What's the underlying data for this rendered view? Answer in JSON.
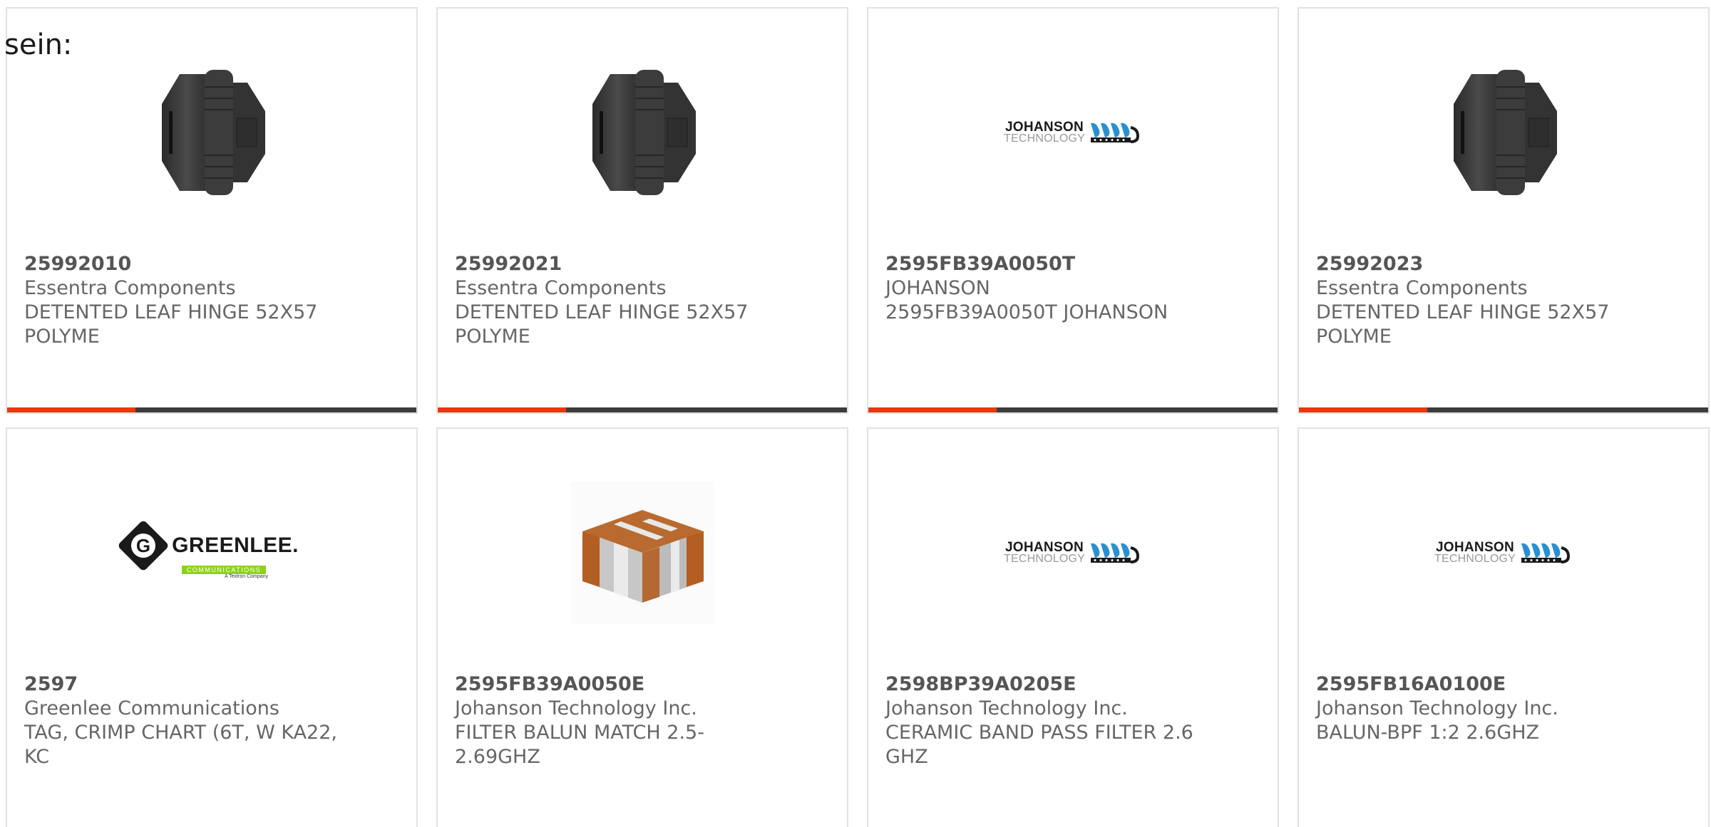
{
  "intro_text": "sein:",
  "colors": {
    "accent": "#e8380d",
    "bar": "#3d3d3d",
    "card_border": "#e2e2e2",
    "text": "#666666"
  },
  "products": [
    {
      "part_number": "25992010",
      "manufacturer": "Essentra Components",
      "description": "DETENTED LEAF HINGE 52X57 POLYME",
      "image": "hinge-image"
    },
    {
      "part_number": "25992021",
      "manufacturer": "Essentra Components",
      "description": "DETENTED LEAF HINGE 52X57 POLYME",
      "image": "hinge-image"
    },
    {
      "part_number": "2595FB39A0050T",
      "manufacturer": "JOHANSON",
      "description": "2595FB39A0050T JOHANSON",
      "image": "johanson-logo"
    },
    {
      "part_number": "25992023",
      "manufacturer": "Essentra Components",
      "description": "DETENTED LEAF HINGE 52X57 POLYME",
      "image": "hinge-image"
    },
    {
      "part_number": "2597",
      "manufacturer": "Greenlee Communications",
      "description": "TAG, CRIMP CHART (6T, W KA22, KC",
      "image": "greenlee-logo"
    },
    {
      "part_number": "2595FB39A0050E",
      "manufacturer": "Johanson Technology Inc.",
      "description": "FILTER BALUN MATCH 2.5-2.69GHZ",
      "image": "chip-component-image"
    },
    {
      "part_number": "2598BP39A0205E",
      "manufacturer": "Johanson Technology Inc.",
      "description": "CERAMIC BAND PASS FILTER 2.6 GHZ",
      "image": "johanson-logo"
    },
    {
      "part_number": "2595FB16A0100E",
      "manufacturer": "Johanson Technology Inc.",
      "description": "BALUN-BPF 1:2 2.6GHZ",
      "image": "johanson-logo"
    }
  ],
  "logos": {
    "johanson_line1": "JOHANSON",
    "johanson_line2": "TECHNOLOGY",
    "greenlee_letter": "G",
    "greenlee_name": "GREENLEE.",
    "greenlee_band": "COMMUNICATIONS",
    "greenlee_sub": "A Textron Company"
  }
}
